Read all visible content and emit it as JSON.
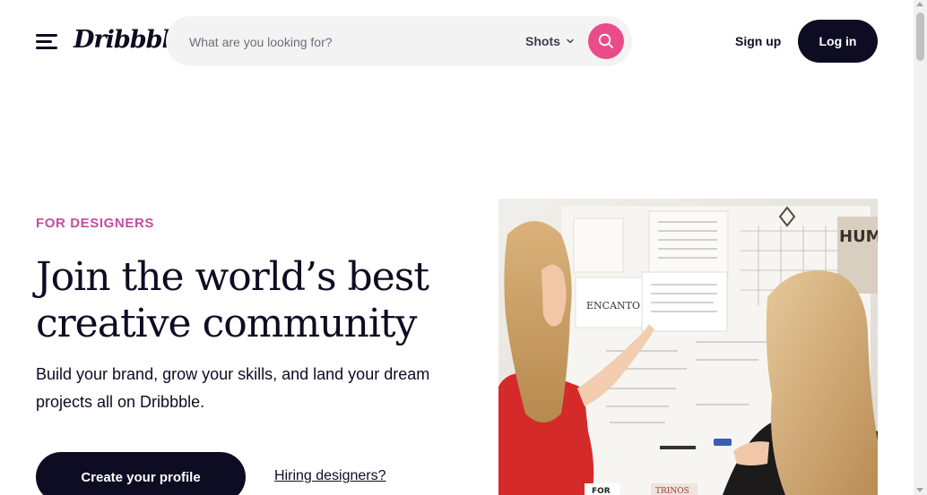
{
  "header": {
    "menu_icon": "hamburger-menu-icon",
    "logo": "Dribbble",
    "search": {
      "placeholder": "What are you looking for?",
      "value": "",
      "type_label": "Shots",
      "type_icon": "chevron-down-icon",
      "button_icon": "search-icon"
    },
    "signup_label": "Sign up",
    "login_label": "Log in"
  },
  "hero": {
    "eyebrow": "FOR DESIGNERS",
    "headline": "Join the world’s best creative community",
    "subtitle": "Build your brand, grow your skills, and land your dream projects all on Dribbble.",
    "cta_label": "Create your profile",
    "secondary_link": "Hiring designers?",
    "image_lettering": {
      "card_word": "ENCANTO",
      "poster_word": "HUMA OVE",
      "bottom_left": "FOR",
      "bottom_mid": "TRINOS"
    }
  },
  "colors": {
    "brand_pink": "#ea4c89",
    "eyebrow": "#c64c9f",
    "dark": "#0d0c22",
    "search_bg": "#f3f3f4"
  }
}
